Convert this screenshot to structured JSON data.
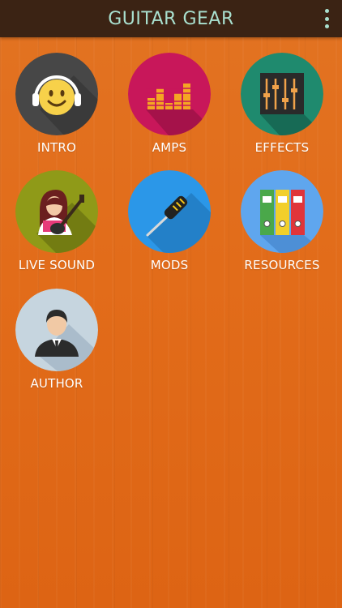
{
  "header": {
    "title": "GUITAR GEAR",
    "menu_icon": "overflow-menu-icon"
  },
  "colors": {
    "header_bg": "#3b2314",
    "header_text": "#a9e0cf",
    "background": "#e26c1a",
    "label_text": "#ffffff"
  },
  "tiles": [
    {
      "label": "INTRO",
      "icon": "headphones-smiley-icon",
      "circle_color": "#474747"
    },
    {
      "label": "AMPS",
      "icon": "equalizer-bars-icon",
      "circle_color": "#c8175a"
    },
    {
      "label": "EFFECTS",
      "icon": "mixer-sliders-icon",
      "circle_color": "#1f8a6e"
    },
    {
      "label": "LIVE SOUND",
      "icon": "guitarist-icon",
      "circle_color": "#8f9a18"
    },
    {
      "label": "MODS",
      "icon": "screwdriver-icon",
      "circle_color": "#2b97e8"
    },
    {
      "label": "RESOURCES",
      "icon": "binders-icon",
      "circle_color": "#5fa6ee"
    },
    {
      "label": "AUTHOR",
      "icon": "person-avatar-icon",
      "circle_color": "#c6d5df"
    }
  ]
}
